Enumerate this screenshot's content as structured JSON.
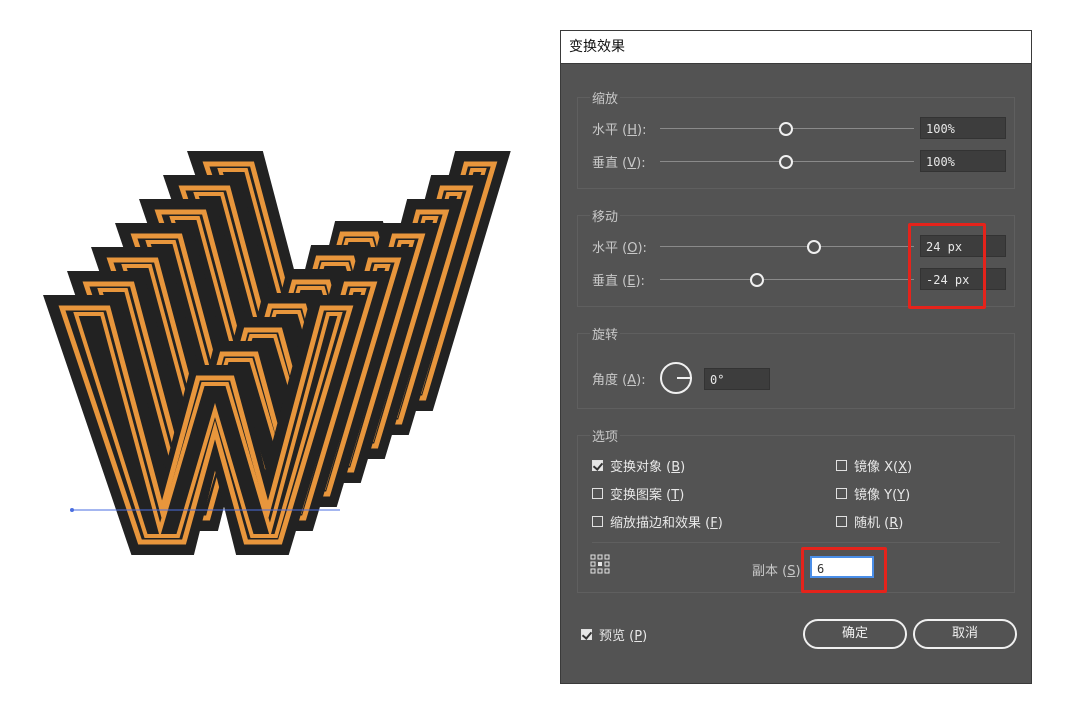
{
  "dialog": {
    "title": "变换效果",
    "scale": {
      "legend": "缩放",
      "horizontal": {
        "label": "水平",
        "key": "H",
        "value": "100%"
      },
      "vertical": {
        "label": "垂直",
        "key": "V",
        "value": "100%"
      }
    },
    "move": {
      "legend": "移动",
      "horizontal": {
        "label": "水平",
        "key": "O",
        "value": "24 px"
      },
      "vertical": {
        "label": "垂直",
        "key": "E",
        "value": "-24 px"
      }
    },
    "rotate": {
      "legend": "旋转",
      "angle": {
        "label": "角度",
        "key": "A",
        "value": "0°"
      }
    },
    "options": {
      "legend": "选项",
      "transform_objects": {
        "label": "变换对象",
        "key": "B",
        "checked": true
      },
      "transform_patterns": {
        "label": "变换图案",
        "key": "T",
        "checked": false
      },
      "scale_strokes": {
        "label": "缩放描边和效果",
        "key": "F",
        "checked": false
      },
      "reflect_x": {
        "label": "镜像 X",
        "key": "X",
        "checked": false
      },
      "reflect_y": {
        "label": "镜像 Y",
        "key": "Y",
        "checked": false
      },
      "random": {
        "label": "随机",
        "key": "R",
        "checked": false
      },
      "copies": {
        "label": "副本",
        "key": "S",
        "value": "6"
      }
    },
    "preview": {
      "label": "预览",
      "key": "P",
      "checked": true
    },
    "ok_label": "确定",
    "cancel_label": "取消"
  },
  "artwork": {
    "letter": "W",
    "fill_color": "#222222",
    "stroke_color": "#e8963c",
    "highlight_color": "#e5231b",
    "guide_color": "#4a6ee0"
  }
}
